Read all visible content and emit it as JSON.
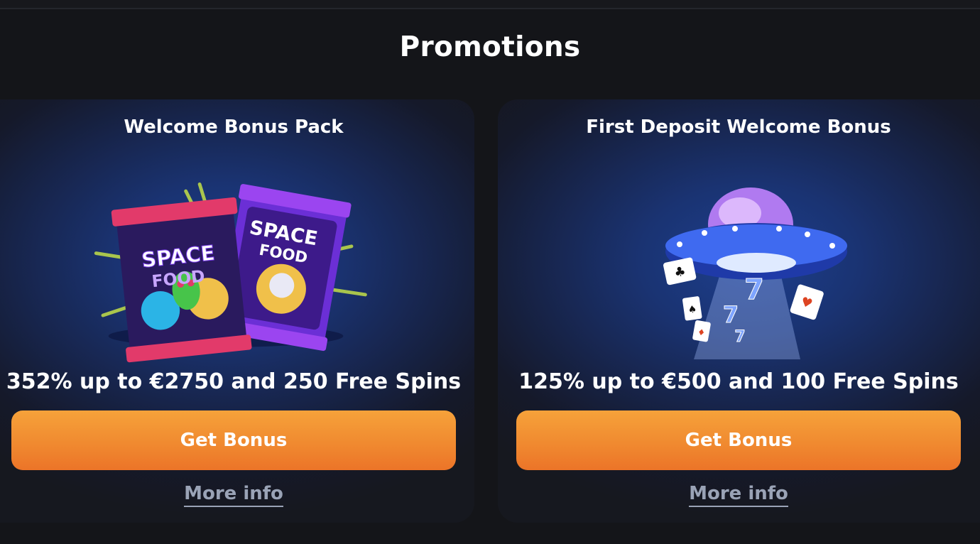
{
  "page": {
    "title": "Promotions"
  },
  "promotions": [
    {
      "title": "Welcome Bonus Pack",
      "illustration": "space-food-snack-bags",
      "package_text": [
        "SPACE",
        "FOOD"
      ],
      "offer": "352% up to €2750 and 250 Free Spins",
      "button_label": "Get Bonus",
      "more_label": "More info"
    },
    {
      "title": "First Deposit Welcome Bonus",
      "illustration": "ufo-beaming-cards-and-sevens",
      "offer": "125% up to €500 and 100 Free Spins",
      "button_label": "Get Bonus",
      "more_label": "More info"
    }
  ],
  "colors": {
    "background": "#141519",
    "button_orange": "#f08a30",
    "link_gray": "#9aa3b6",
    "card_blue": "#1d3f8e"
  }
}
